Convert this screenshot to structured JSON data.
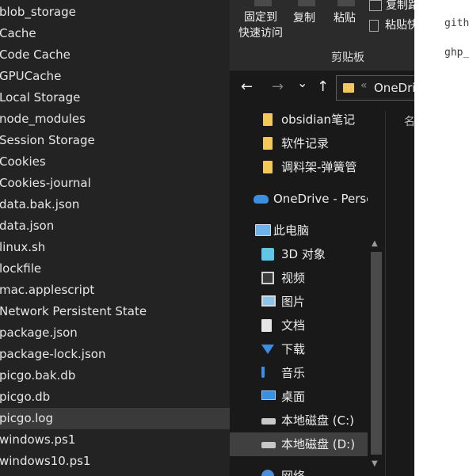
{
  "file_list": [
    "blob_storage",
    "Cache",
    "Code Cache",
    "GPUCache",
    "Local Storage",
    "node_modules",
    "Session Storage",
    "Cookies",
    "Cookies-journal",
    "data.bak.json",
    "data.json",
    "linux.sh",
    "lockfile",
    "mac.applescript",
    "Network Persistent State",
    "package.json",
    "package-lock.json",
    "picgo.bak.db",
    "picgo.db",
    "picgo.log",
    "windows.ps1",
    "windows10.ps1"
  ],
  "file_list_selected": "picgo.log",
  "ribbon": {
    "pin_line1": "固定到",
    "pin_line2": "快速访问",
    "copy": "复制",
    "paste": "粘贴",
    "copy_path": "复制路",
    "paste_shortcut": "粘贴快",
    "group_label": "剪贴板"
  },
  "address": {
    "back_icon": "←",
    "forward_icon": "→",
    "dropdown_icon": "⌄",
    "up_icon": "↑",
    "separator": "«",
    "path": "OneDrive"
  },
  "column_header": "名",
  "nav_items": [
    {
      "label": "obsidian笔记",
      "icon": "folder-icon"
    },
    {
      "label": "软件记录",
      "icon": "folder-icon"
    },
    {
      "label": "调料架-弹簧管",
      "icon": "folder-icon"
    },
    {
      "label": "OneDrive - Perso",
      "icon": "cloud-icon"
    },
    {
      "label": "此电脑",
      "icon": "computer-icon"
    },
    {
      "label": "3D 对象",
      "icon": "cube-icon"
    },
    {
      "label": "视频",
      "icon": "film-icon"
    },
    {
      "label": "图片",
      "icon": "picture-icon"
    },
    {
      "label": "文档",
      "icon": "document-icon"
    },
    {
      "label": "下载",
      "icon": "download-icon"
    },
    {
      "label": "音乐",
      "icon": "music-icon"
    },
    {
      "label": "桌面",
      "icon": "desktop-icon"
    },
    {
      "label": "本地磁盘 (C:)",
      "icon": "drive-icon"
    },
    {
      "label": "本地磁盘 (D:)",
      "icon": "drive-icon"
    },
    {
      "label": "网络",
      "icon": "network-icon"
    }
  ],
  "nav_selected": "本地磁盘 (D:)",
  "doc_lines": [
    "gith",
    "ghp_"
  ],
  "colors": {
    "folder": "#f2c75c",
    "onedrive": "#3b8fe0",
    "download": "#3b8fe0",
    "music": "#3b8fe0"
  }
}
